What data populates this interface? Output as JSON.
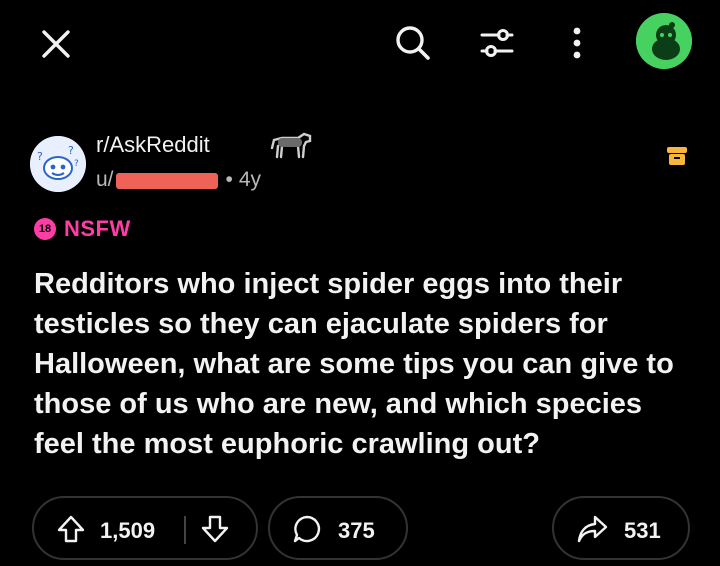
{
  "post": {
    "subreddit": "r/AskReddit",
    "author_prefix": "u/",
    "age": "4y",
    "nsfw_badge": "18",
    "nsfw_label": "NSFW",
    "title": "Redditors who inject spider eggs into their testicles so they can ejaculate spiders for Halloween, what are some tips you can give to those of us who are new, and which species feel the most euphoric crawling out?"
  },
  "actions": {
    "upvotes": "1,509",
    "comments": "375",
    "shares": "531"
  },
  "colors": {
    "background": "#000000",
    "nsfw": "#ff3ea5",
    "profile": "#46d160",
    "save_icon": "#f6b73c",
    "redaction": "#ef6257"
  },
  "icons": [
    "close-icon",
    "search-icon",
    "filter-icon",
    "more-icon",
    "profile-avatar",
    "save-icon",
    "upvote-icon",
    "downvote-icon",
    "comment-icon",
    "share-icon"
  ]
}
